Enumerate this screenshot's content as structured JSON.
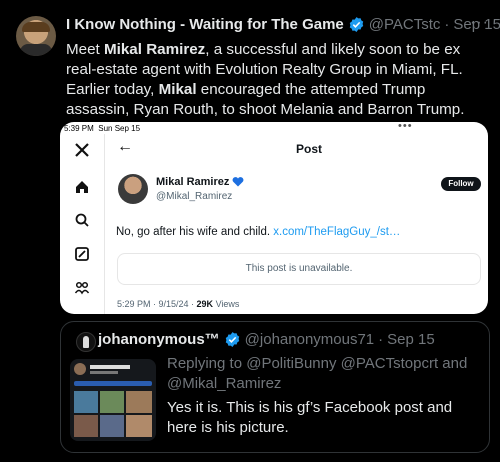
{
  "tweet": {
    "author_name": "I Know Nothing - Waiting for The Game",
    "author_handle": "@PACTstc",
    "separator": "·",
    "date": "Sep 15",
    "more_label": "···",
    "text_parts": [
      "Meet ",
      "Mikal Ramirez",
      ", a successful and likely soon to be ex real-estate agent with Evolution Realty Group in Miami, FL. Earlier today, ",
      "Mikal",
      " encouraged the attempted Trump assassin, Ryan Routh, to shoot Melania and Barron Trump."
    ]
  },
  "screenshot": {
    "status_time": "5:39 PM",
    "status_date": "Sun Sep 15",
    "dots": "•••",
    "post_title": "Post",
    "back_label": "←",
    "rail_icons": [
      "x-logo-icon",
      "home-icon",
      "search-icon",
      "compose-icon",
      "communities-icon"
    ],
    "post_author_name": "Mikal Ramirez",
    "post_author_handle": "@Mikal_Ramirez",
    "follow_label": "Follow",
    "post_text": "No, go after his wife and child. ",
    "post_link": "x.com/TheFlagGuy_/st…",
    "unavailable_text": "This post is unavailable.",
    "meta_time": "5:29 PM · 9/15/24 · ",
    "meta_views_count": "29K",
    "meta_views_label": " Views"
  },
  "quote": {
    "author_name": "johanonymous™",
    "author_handle": "@johanonymous71",
    "separator": "·",
    "date": "Sep 15",
    "replying_prefix": "Replying to ",
    "replying_mentions": "@PolitiBunny @PACTstopcrt and @Mikal_Ramirez",
    "text": "Yes it is. This is his gf’s Facebook post and here is his picture."
  },
  "colors": {
    "verified": "#1d9bf0",
    "background": "#000000",
    "muted": "#71767b"
  }
}
